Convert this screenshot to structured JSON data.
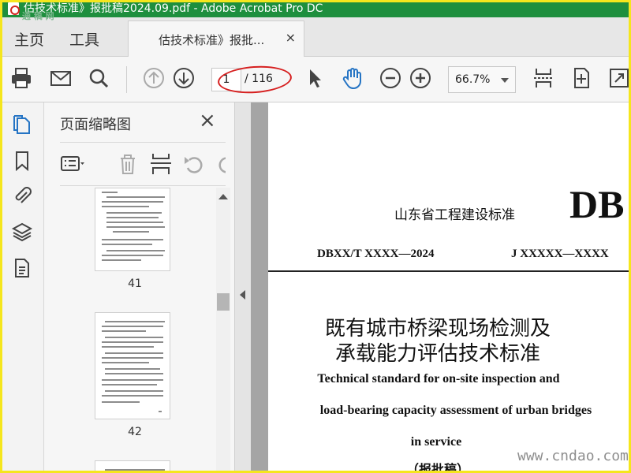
{
  "window": {
    "title": "估技术标准》报批稿2024.09.pdf - Adobe Acrobat Pro DC",
    "watermark_logo": "通 稿 网"
  },
  "menu": {
    "home": "主页",
    "tools": "工具"
  },
  "tab": {
    "title": "估技术标准》报批...",
    "close": "×"
  },
  "toolbar": {
    "current_page": "1",
    "page_total": "/ 116",
    "zoom": "66.7%",
    "icons": [
      "print-icon",
      "email-icon",
      "search-icon",
      "prev-page-icon",
      "next-page-icon",
      "select-cursor-icon",
      "hand-tool-icon",
      "zoom-out-icon",
      "zoom-in-icon",
      "page-split-icon",
      "fit-page-icon",
      "fullscreen-icon"
    ],
    "highlight_color": "#d61f1f"
  },
  "leftnav": {
    "icons": [
      "page-thumbnails-icon",
      "bookmark-icon",
      "attachment-icon",
      "layers-icon",
      "document-properties-icon"
    ],
    "accent_color": "#2574c4"
  },
  "thumbnails": {
    "title": "页面缩略图",
    "close": "×",
    "pages": [
      {
        "label": "41"
      },
      {
        "label": "42"
      }
    ]
  },
  "document": {
    "standard_title": "山东省工程建设标准",
    "logo": "DB",
    "code_left": "DBXX/T XXXX—2024",
    "code_right": "J XXXXX—XXXX",
    "title_cn_line1": "既有城市桥梁现场检测及",
    "title_cn_line2": "承载能力评估技术标准",
    "title_en_line1": "Technical standard for on-site inspection and",
    "title_en_line2": "load-bearing capacity assessment of urban bridges",
    "title_en_line3": "in service",
    "draft": "（报批稿）"
  },
  "site_watermark": "www.cndao.com",
  "colors": {
    "titlebar": "#1e8f3e",
    "frame": "#f5e61d"
  }
}
